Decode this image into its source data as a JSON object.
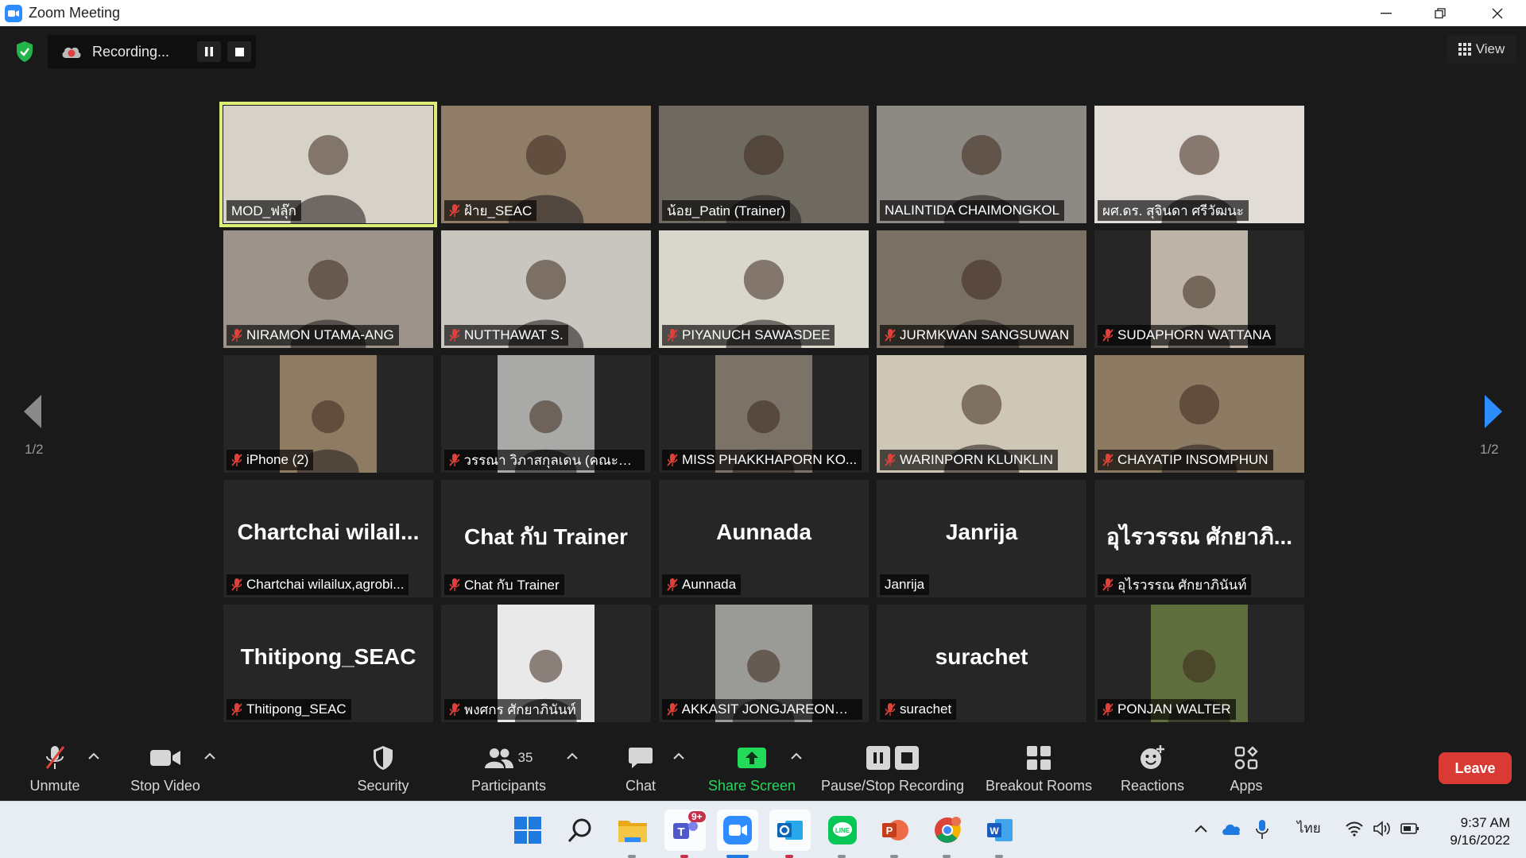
{
  "window": {
    "title": "Zoom Meeting"
  },
  "recording": {
    "label": "Recording..."
  },
  "view": {
    "label": "View"
  },
  "pagination": {
    "left": "1/2",
    "right": "1/2"
  },
  "participants": [
    {
      "name": "MOD_ฟลุ๊ก",
      "muted": false,
      "video": true,
      "active": true,
      "bg": "#d7d2c8"
    },
    {
      "name": "ฝ้าย_SEAC",
      "muted": true,
      "video": true,
      "bg": "#8f7d68"
    },
    {
      "name": "น้อย_Patin (Trainer)",
      "muted": false,
      "video": true,
      "bg": "#6f6a60"
    },
    {
      "name": "NALINTIDA CHAIMONGKOL",
      "muted": false,
      "video": true,
      "bg": "#8d8a84"
    },
    {
      "name": "ผศ.ดร. สุจินดา ศรีวัฒนะ",
      "muted": false,
      "video": true,
      "bg": "#e2dcd6"
    },
    {
      "name": "NIRAMON UTAMA-ANG",
      "muted": true,
      "video": true,
      "bg": "#9c948a"
    },
    {
      "name": "NUTTHAWAT S.",
      "muted": true,
      "video": true,
      "bg": "#c9c6bf"
    },
    {
      "name": "PIYANUCH SAWASDEE",
      "muted": true,
      "video": true,
      "bg": "#d9d6cc"
    },
    {
      "name": "JURMKWAN SANGSUWAN",
      "muted": true,
      "video": true,
      "bg": "#7a7064"
    },
    {
      "name": "SUDAPHORN WATTANA",
      "muted": true,
      "video": true,
      "narrow": true,
      "bg": "#bdb3a6"
    },
    {
      "name": "iPhone (2)",
      "muted": true,
      "video": true,
      "narrow": true,
      "bg": "#8f7a62"
    },
    {
      "name": "วรรณา วิภาสกุลเดน (คณะอุต...",
      "muted": true,
      "video": true,
      "narrow": true,
      "bg": "#a9aaa7"
    },
    {
      "name": "MISS PHAKKHAPORN KO...",
      "muted": true,
      "video": true,
      "narrow": true,
      "bg": "#7b7268"
    },
    {
      "name": "WARINPORN KLUNKLIN",
      "muted": true,
      "video": true,
      "bg": "#cfc7b6"
    },
    {
      "name": "CHAYATIP INSOMPHUN",
      "muted": true,
      "video": true,
      "bg": "#8c7a62"
    },
    {
      "name": "Chartchai wilailux,agrobi...",
      "display": "Chartchai wilail...",
      "muted": true,
      "video": false
    },
    {
      "name": "Chat กับ Trainer",
      "display": "Chat กับ Trainer",
      "muted": true,
      "video": false
    },
    {
      "name": "Aunnada",
      "display": "Aunnada",
      "muted": true,
      "video": false
    },
    {
      "name": "Janrija",
      "display": "Janrija",
      "muted": false,
      "video": false
    },
    {
      "name": "อุไรวรรณ ศักยาภินันท์",
      "display": "อุไรวรรณ ศักยาภิ...",
      "muted": true,
      "video": false
    },
    {
      "name": "Thitipong_SEAC",
      "display": "Thitipong_SEAC",
      "muted": true,
      "video": false
    },
    {
      "name": "พงศกร ศักยาภินันท์",
      "muted": true,
      "video": true,
      "narrow": true,
      "bg": "#e9e9e9"
    },
    {
      "name": "AKKASIT JONGJAREONRAK",
      "muted": true,
      "video": true,
      "narrow": true,
      "bg": "#9a9a96"
    },
    {
      "name": "surachet",
      "display": "surachet",
      "muted": true,
      "video": false
    },
    {
      "name": "PONJAN WALTER",
      "muted": true,
      "video": true,
      "narrow": true,
      "bg": "#5e6e3c"
    }
  ],
  "toolbar": {
    "unmute": "Unmute",
    "stop_video": "Stop Video",
    "security": "Security",
    "participants": "Participants",
    "participant_count": "35",
    "chat": "Chat",
    "share_screen": "Share Screen",
    "pause_stop_recording": "Pause/Stop Recording",
    "breakout_rooms": "Breakout Rooms",
    "reactions": "Reactions",
    "apps": "Apps",
    "leave": "Leave"
  },
  "taskbar": {
    "teams_badge": "9+",
    "language": "ไทย",
    "time": "9:37 AM",
    "date": "9/16/2022"
  },
  "colors": {
    "accent_blue": "#2d8cff",
    "share_green": "#23d959",
    "leave_red": "#d93a33",
    "active_speaker": "#ddee77",
    "muted_red": "#e0403a"
  }
}
